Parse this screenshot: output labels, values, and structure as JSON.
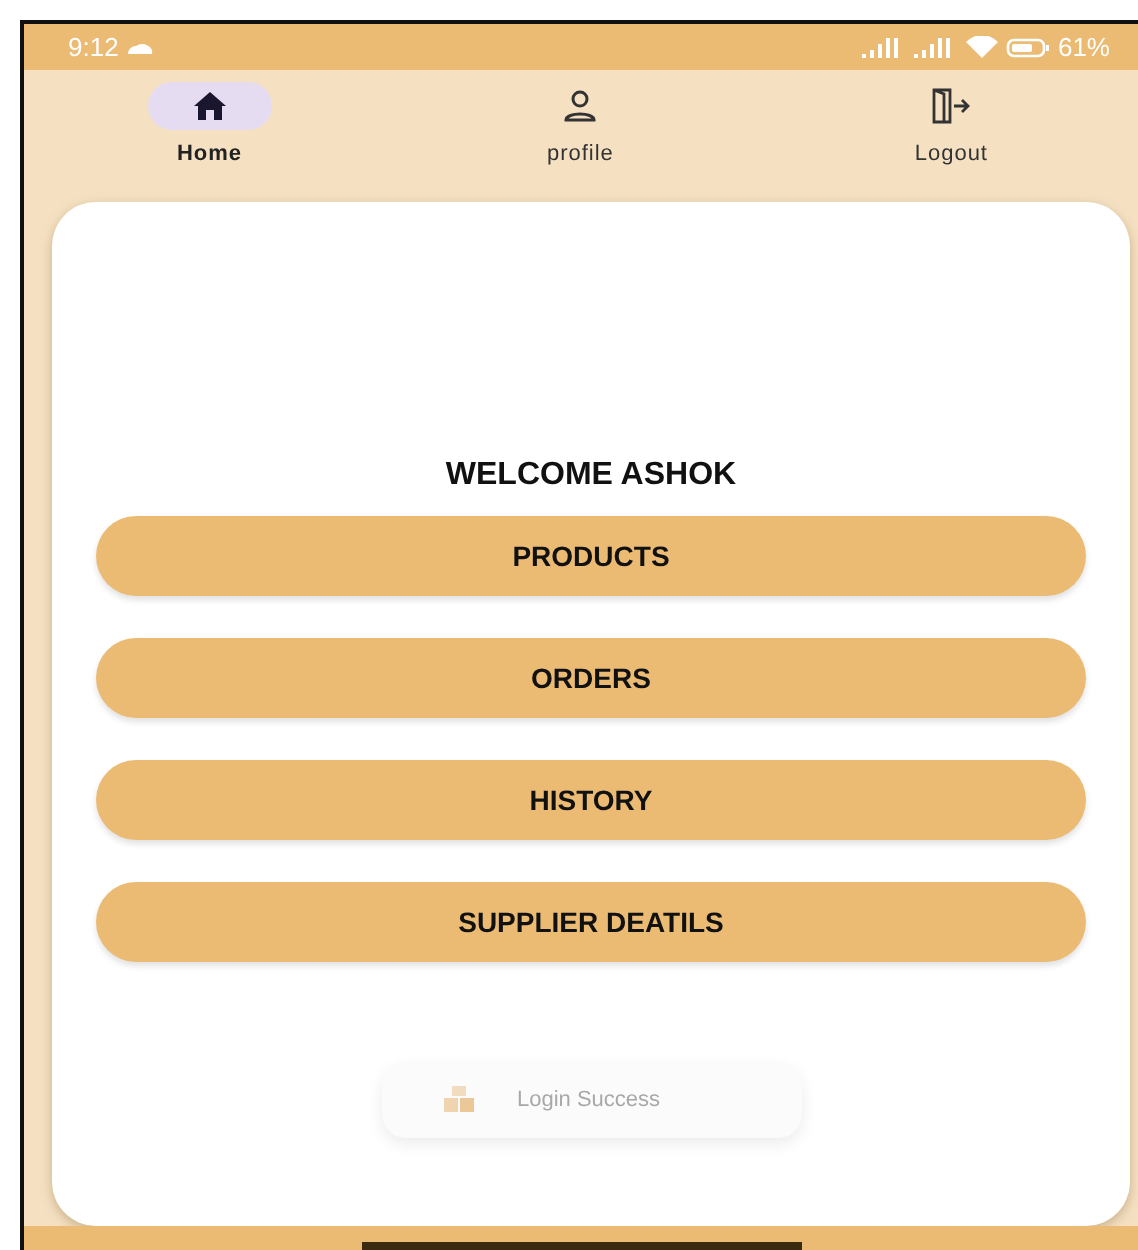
{
  "status_bar": {
    "time": "9:12",
    "battery": "61%"
  },
  "tabs": [
    {
      "label": "Home",
      "kind": "home",
      "selected": true
    },
    {
      "label": "profile",
      "kind": "person",
      "selected": false
    },
    {
      "label": "Logout",
      "kind": "logout",
      "selected": false
    }
  ],
  "welcome": "WELCOME ASHOK",
  "buttons": [
    "PRODUCTS",
    "ORDERS",
    "HISTORY",
    "SUPPLIER DEATILS"
  ],
  "toast": {
    "text": "Login Success"
  }
}
